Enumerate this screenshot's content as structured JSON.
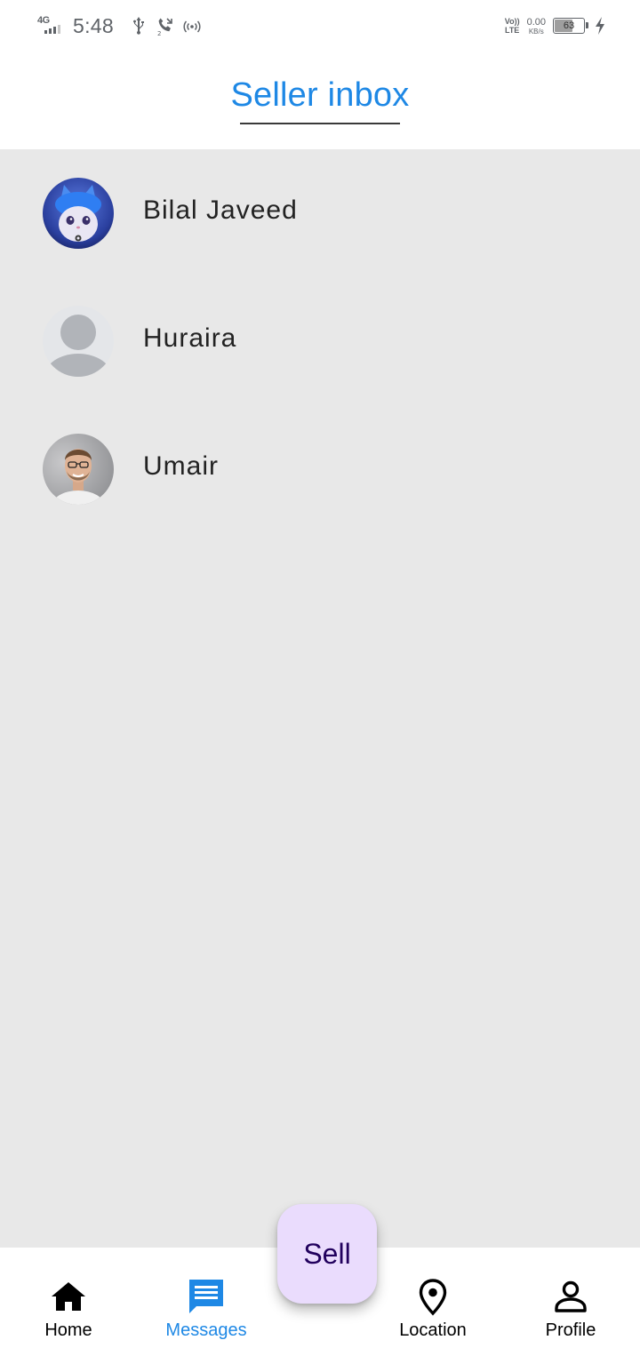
{
  "status_bar": {
    "network": "4G",
    "time": "5:48",
    "volte_top": "Vo))",
    "volte_bottom": "LTE",
    "speed_value": "0.00",
    "speed_unit": "KB/s",
    "battery_level": "63",
    "battery_fraction": 0.63
  },
  "app_bar": {
    "title": "Seller inbox"
  },
  "contacts": [
    {
      "name": "Bilal Javeed",
      "avatar": "cat-avatar"
    },
    {
      "name": "Huraira",
      "avatar": "default-avatar"
    },
    {
      "name": "Umair",
      "avatar": "photo-avatar"
    }
  ],
  "bottom_nav": {
    "items": [
      {
        "label": "Home",
        "icon": "home-icon",
        "active": false
      },
      {
        "label": "Messages",
        "icon": "message-icon",
        "active": true
      },
      {
        "label": "Location",
        "icon": "location-pin-icon",
        "active": false
      },
      {
        "label": "Profile",
        "icon": "person-icon",
        "active": false
      }
    ],
    "sell_label": "Sell"
  },
  "colors": {
    "accent": "#1e88e5",
    "content_bg": "#e8e8e8",
    "fab_bg": "#eadcfd",
    "fab_text": "#21005d"
  }
}
